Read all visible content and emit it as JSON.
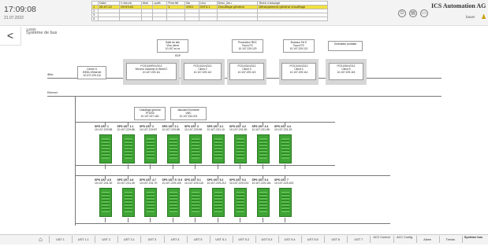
{
  "header": {
    "time": "17:09:08",
    "date": "21.07.2022",
    "brand": "ICS Automation AG",
    "user": "bauer",
    "alarm_table": {
      "columns": [
        "Date",
        "h:heure",
        "état",
        "quitt.",
        "Priorité",
        "No",
        "Lieu",
        "Desc_lieu",
        "Texte message"
      ],
      "rows": [
        [
          "1",
          "26.07.22",
          "09:53:02",
          "",
          "",
          "1",
          "2901",
          "OST4.1",
          "Chauffage général",
          "Dérangement général chauffage"
        ],
        [
          "2",
          "",
          "",
          "",
          "",
          "",
          "",
          "",
          "",
          ""
        ],
        [
          "3",
          "",
          "",
          "",
          "",
          "",
          "",
          "",
          "",
          ""
        ],
        [
          "4",
          "",
          "",
          "",
          "",
          "",
          "",
          "",
          "",
          ""
        ]
      ]
    }
  },
  "page": {
    "code": "14000",
    "title": "Système de bus"
  },
  "labels": {
    "bus1": "iBMc",
    "bus2": "Ethernet",
    "rdp": "RDP"
  },
  "top_boxes": [
    {
      "l1": "Salle de site",
      "l2": "Vhm client",
      "l3": "10.107.xx.xx"
    },
    {
      "l1": "Production RDC",
      "l2": "Touch PC",
      "l3": "10.107.229.120"
    },
    {
      "l1": "Bureaux Tet E",
      "l2": "Touch PC",
      "l3": "10.107.229.121"
    },
    {
      "l1": "Ordinateur portable",
      "l2": "",
      "": "",
      "l3": ""
    }
  ],
  "gateway": {
    "l1": "Centre 6",
    "l2": "iSEDU-Ethernet",
    "l3": "10.107.229.110"
  },
  "pcs": [
    {
      "l1": "PCS100/IR/LVD12",
      "l2": "Serveur d'alarme et WebCC",
      "l3": "10.107.229.111"
    },
    {
      "l1": "PCS102/LVD12",
      "l2": "Client 2",
      "l3": "10.107.229.112"
    },
    {
      "l1": "PCS103/LVD12",
      "l2": "Client 3",
      "l3": "10.107.229.113"
    },
    {
      "l1": "PCS104/LVD12",
      "l2": "Client 4",
      "l3": "10.107.229.114"
    },
    {
      "l1": "PCS105/LVD12",
      "l2": "Client 5",
      "l3": "10.107.229.115"
    }
  ],
  "mid_boxes": [
    {
      "l1": "Chauffage général",
      "l2": "TP1000",
      "l3": "10.107.237.160"
    },
    {
      "l1": "Jalousie/Cheminée",
      "l2": "VMC",
      "l3": "10.107.234.201"
    }
  ],
  "sps_row1": [
    {
      "n": "SPS UST 1",
      "ip": "10.107.229.85"
    },
    {
      "n": "SPS UST 1.1",
      "ip": "10.107.229.86"
    },
    {
      "n": "SPS UST 2",
      "ip": "10.107.229.87"
    },
    {
      "n": "SPS UST 2.1",
      "ip": "10.107.229.88"
    },
    {
      "n": "SPS UST 3",
      "ip": "10.107.229.89"
    },
    {
      "n": "SPS UST 4.1",
      "ip": "10.107.231.10"
    },
    {
      "n": "SPS UST 4.2",
      "ip": "10.107.231.50"
    },
    {
      "n": "SPS UST 4.3",
      "ip": "10.107.231.55"
    },
    {
      "n": "SPS UST 4.4",
      "ip": "10.107.231.20"
    }
  ],
  "sps_row2": [
    {
      "n": "SPS UST 4.5",
      "ip": "10.107.231.30"
    },
    {
      "n": "SPS UST 4.6",
      "ip": "10.107.231.40"
    },
    {
      "n": "SPS UST 4.7",
      "ip": "10.107.231.70"
    },
    {
      "n": "SPS UST 5 / 5.5",
      "ip": "10.107.229.100"
    },
    {
      "n": "SPS UST 5.1",
      "ip": "10.107.229.110"
    },
    {
      "n": "SPS UST 5.2",
      "ip": "10.107.229.212"
    },
    {
      "n": "SPS UST 5.3",
      "ip": "10.107.229.213"
    },
    {
      "n": "SPS UST 5.4",
      "ip": "10.107.229.161"
    },
    {
      "n": "SPS UST 7",
      "ip": "10.107.229.102"
    }
  ],
  "nav": {
    "tabs": [
      "UST 1",
      "UST 1.1",
      "UST 2",
      "UST 2.1",
      "UST 3",
      "UST 4",
      "UST 5",
      "UST 5.1",
      "UST 5.2",
      "UST 5.3",
      "UST 5.4",
      "UST 5.5",
      "UST 6",
      "UST 7",
      "ACC Control",
      "ACC Config",
      "Alarm",
      "Trends",
      "Système bus"
    ],
    "active": "Système bus"
  },
  "colors": {
    "active_alarm": "#f2e040",
    "plc_green": "#3fa335",
    "brand": "#333333",
    "user_icon": "#c79b00"
  }
}
